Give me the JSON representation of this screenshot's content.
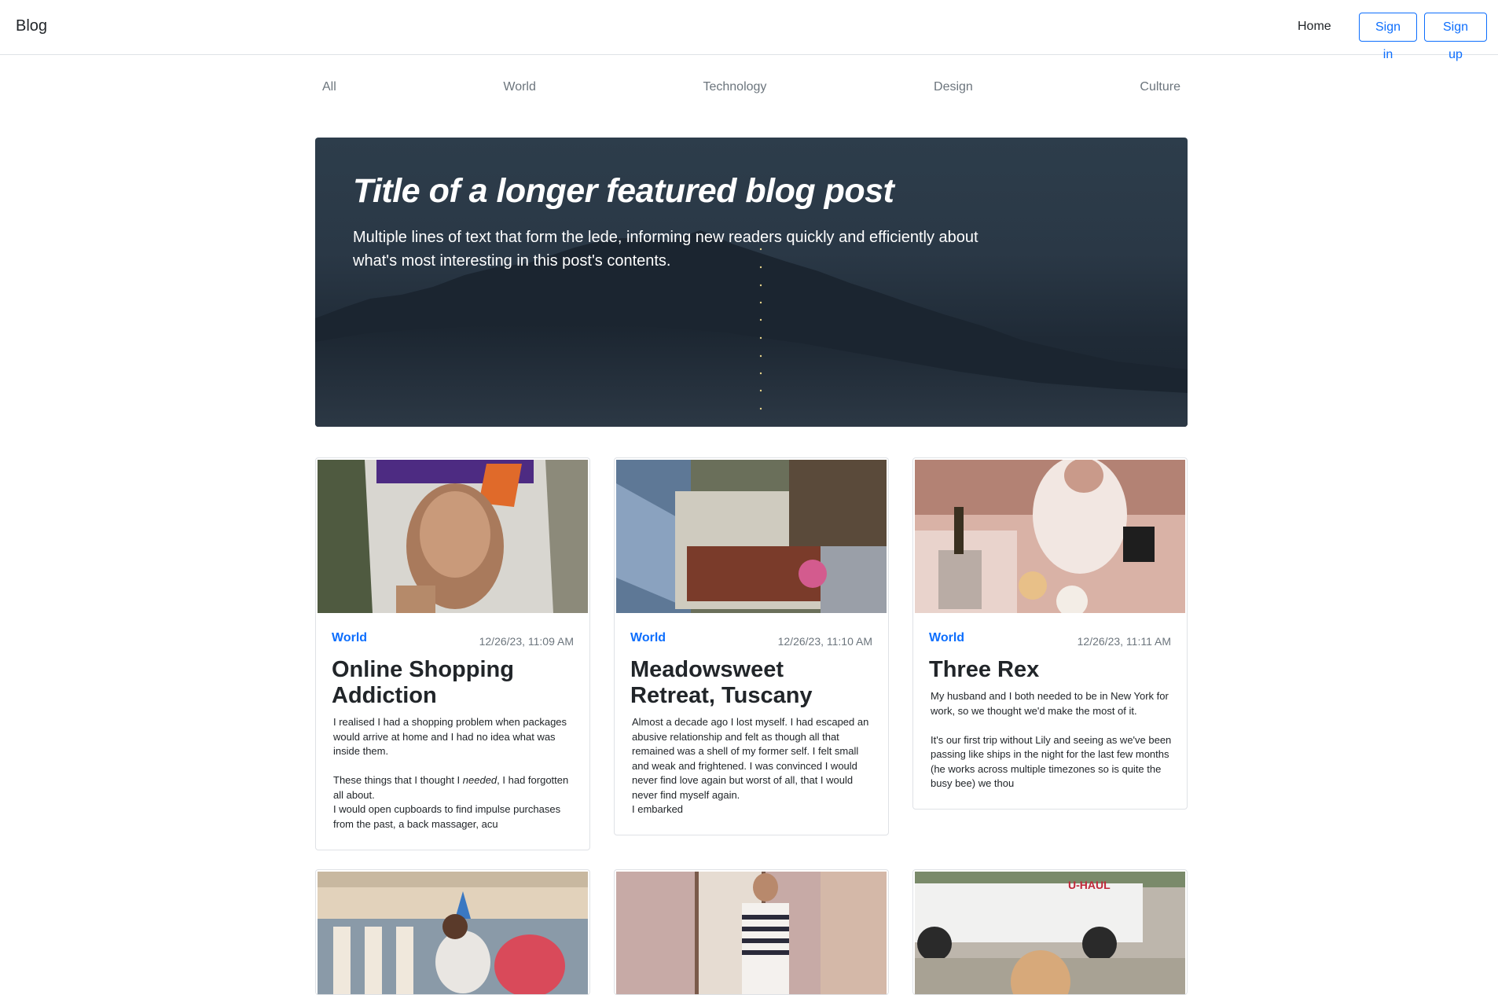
{
  "header": {
    "brand": "Blog",
    "home": "Home",
    "signin": "Sign in",
    "signup": "Sign up"
  },
  "categories": [
    "All",
    "World",
    "Technology",
    "Design",
    "Culture"
  ],
  "hero": {
    "title": "Title of a longer featured blog post",
    "lede": "Multiple lines of text that form the lede, informing new readers quickly and efficiently about what's most interesting in this post's contents."
  },
  "posts": [
    {
      "category": "World",
      "date": "12/26/23, 11:09 AM",
      "title": "Online Shopping Addiction",
      "excerpt": {
        "p1": "I realised I had a shopping problem when packages would arrive at home and I had no idea what was inside them.",
        "p2_before": "These things that I thought I ",
        "p2_em": "needed",
        "p2_after": ", I had forgotten all about.",
        "p3": "I would open cupboards to find impulse purchases from the past, a back massager, acu"
      }
    },
    {
      "category": "World",
      "date": "12/26/23, 11:10 AM",
      "title": "Meadowsweet Retreat, Tuscany",
      "excerpt": {
        "p1": "Almost a decade ago I lost myself. I had escaped an abusive relationship and felt as though all that remained was a shell of my former self. I felt small and weak and frightened. I was convinced I would never find love again but worst of all, that I would never find myself again.",
        "p2": "I embarked"
      }
    },
    {
      "category": "World",
      "date": "12/26/23, 11:11 AM",
      "title": "Three Rex",
      "excerpt": {
        "p1": "My husband and I both needed to be in New York for work, so we thought we'd make the most of it.",
        "p2": "It's our first trip without Lily and seeing as we've been passing like ships in the night for the last few months (he works across multiple timezones so is quite the busy bee) we thou"
      }
    }
  ],
  "van_text": "U-HAUL"
}
